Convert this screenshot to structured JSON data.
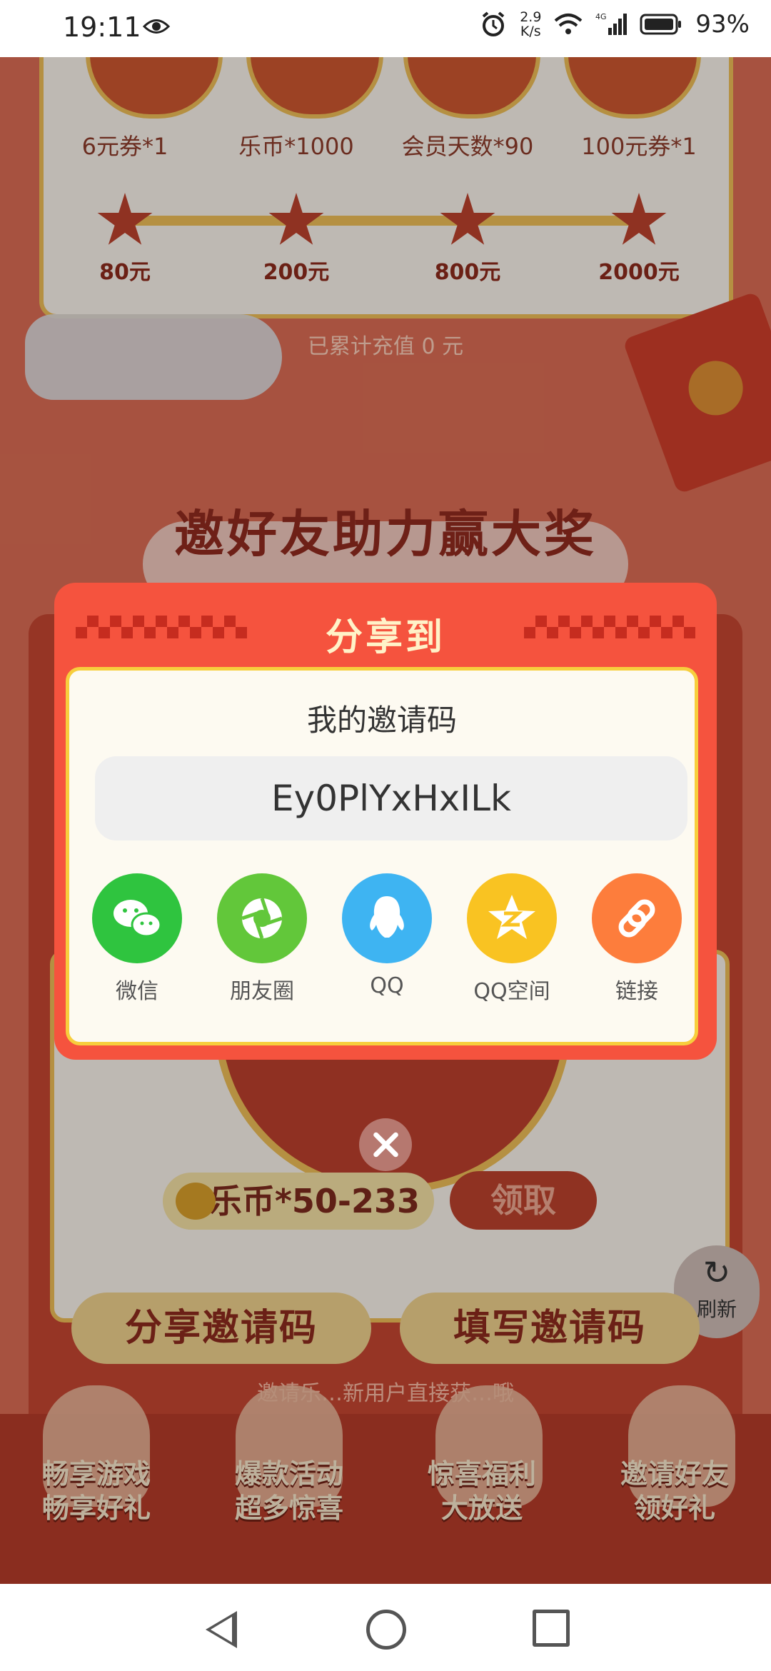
{
  "status_bar": {
    "time": "19:11",
    "net_speed_value": "2.9",
    "net_speed_unit": "K/s",
    "battery": "93%",
    "network": "4G"
  },
  "background": {
    "rewards": [
      "6元券*1",
      "乐币*1000",
      "会员天数*90",
      "100元券*1"
    ],
    "tiers": [
      "80元",
      "200元",
      "800元",
      "2000元"
    ],
    "recharge_text": "已累计充值 0 元",
    "invite_title": "邀好友助力赢大奖",
    "coins_reward": "乐币*50-233",
    "claim_label": "领取",
    "refresh_label": "刷新",
    "share_code_button": "分享邀请码",
    "fill_code_button": "填写邀请码",
    "hint_text": "邀请乐…新用户直接获…哦",
    "bottom_tags": [
      {
        "l1": "畅享游戏",
        "l2": "畅享好礼"
      },
      {
        "l1": "爆款活动",
        "l2": "超多惊喜"
      },
      {
        "l1": "惊喜福利",
        "l2": "大放送"
      },
      {
        "l1": "邀请好友",
        "l2": "领好礼"
      }
    ]
  },
  "share_dialog": {
    "title": "分享到",
    "code_label": "我的邀请码",
    "invite_code": "Ey0PlYxHxILk",
    "targets": [
      {
        "label": "微信",
        "icon": "wechat-icon",
        "color": "#2fc43f"
      },
      {
        "label": "朋友圈",
        "icon": "moments-icon",
        "color": "#62c73a"
      },
      {
        "label": "QQ",
        "icon": "qq-icon",
        "color": "#3eb4f2"
      },
      {
        "label": "QQ空间",
        "icon": "qzone-icon",
        "color": "#f9c322"
      },
      {
        "label": "链接",
        "icon": "link-icon",
        "color": "#fd7d3c"
      }
    ]
  },
  "colors": {
    "dialog_red": "#f5533e",
    "dialog_border": "#f7ce3d"
  }
}
